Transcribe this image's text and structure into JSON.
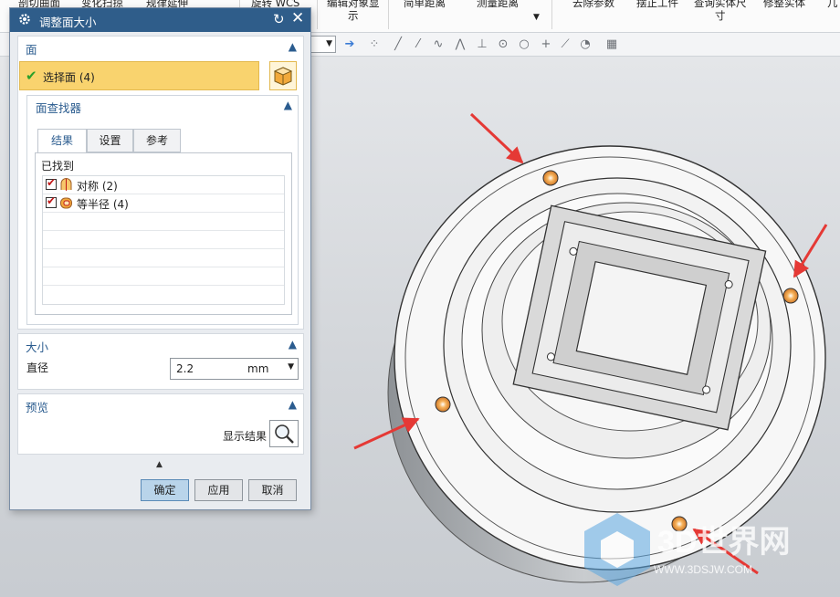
{
  "ribbon": {
    "items": [
      {
        "label": "剖切曲面"
      },
      {
        "label": "变化扫掠"
      },
      {
        "label": "规律延伸"
      },
      {
        "label": "旋转 WCS"
      },
      {
        "label": "编辑对象显\n示"
      },
      {
        "label": "简单距离"
      },
      {
        "label": "测量距离"
      },
      {
        "label": "去除参数"
      },
      {
        "label": "摆正工件"
      },
      {
        "label": "查询实体尺\n寸"
      },
      {
        "label": "修整实体"
      },
      {
        "label": "几"
      }
    ]
  },
  "dialog": {
    "title": "调整面大小",
    "face_group": {
      "title": "面",
      "select_label": "选择面 (4)",
      "finder": {
        "title": "面查找器",
        "tabs": [
          {
            "label": "结果"
          },
          {
            "label": "设置"
          },
          {
            "label": "参考"
          }
        ],
        "found_label": "已找到",
        "results": [
          {
            "label": "对称 (2)",
            "checked": true
          },
          {
            "label": "等半径 (4)",
            "checked": true
          }
        ]
      }
    },
    "size_group": {
      "title": "大小",
      "diameter_label": "直径",
      "diameter_value": "2.2",
      "unit": "mm"
    },
    "preview_group": {
      "title": "预览",
      "show_result_label": "显示结果"
    },
    "buttons": {
      "ok": "确定",
      "apply": "应用",
      "cancel": "取消"
    }
  },
  "watermark": {
    "text_cn": "3D世界网",
    "url": "WWW.3DSJW.COM"
  },
  "colors": {
    "title_bar": "#2f5d8a",
    "accent_text": "#2b5c8f",
    "selected_row": "#f9d36e",
    "annotation_arrow": "#e53935",
    "highlighted_face": "#f29a38"
  }
}
